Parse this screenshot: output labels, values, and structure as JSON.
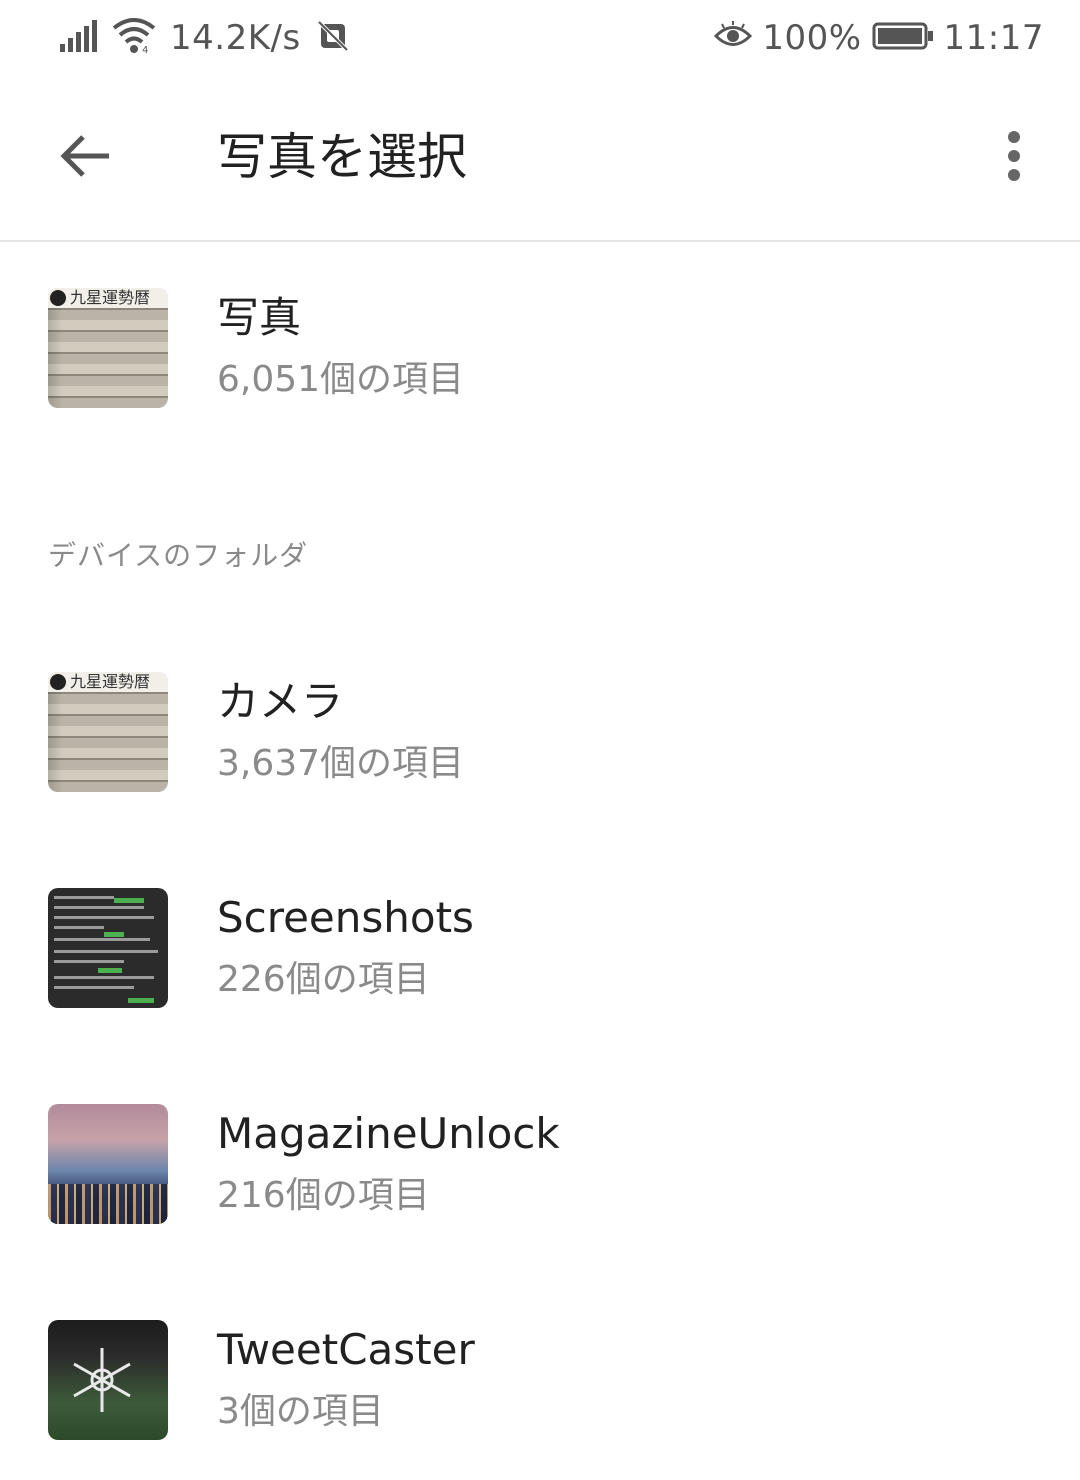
{
  "status_bar": {
    "net_speed": "14.2K/s",
    "battery_percent": "100%",
    "time": "11:17",
    "icons": [
      "signal-icon",
      "wifi-icon",
      "mute-icon",
      "eye-comfort-icon",
      "battery-icon"
    ]
  },
  "app_bar": {
    "title": "写真を選択",
    "back_icon": "arrow-back-icon",
    "menu_icon": "more-vert-icon"
  },
  "top_album": {
    "title": "写真",
    "count": "6,051個の項目"
  },
  "section": {
    "header": "デバイスのフォルダ"
  },
  "folders": [
    {
      "title": "カメラ",
      "count": "3,637個の項目"
    },
    {
      "title": "Screenshots",
      "count": "226個の項目"
    },
    {
      "title": "MagazineUnlock",
      "count": "216個の項目"
    },
    {
      "title": "TweetCaster",
      "count": "3個の項目"
    }
  ],
  "thumb_heading_text": "九星運勢暦",
  "colors": {
    "primary_text": "#212121",
    "secondary_text": "#8a8a8a",
    "divider": "#e6e6e6",
    "background": "#ffffff"
  }
}
